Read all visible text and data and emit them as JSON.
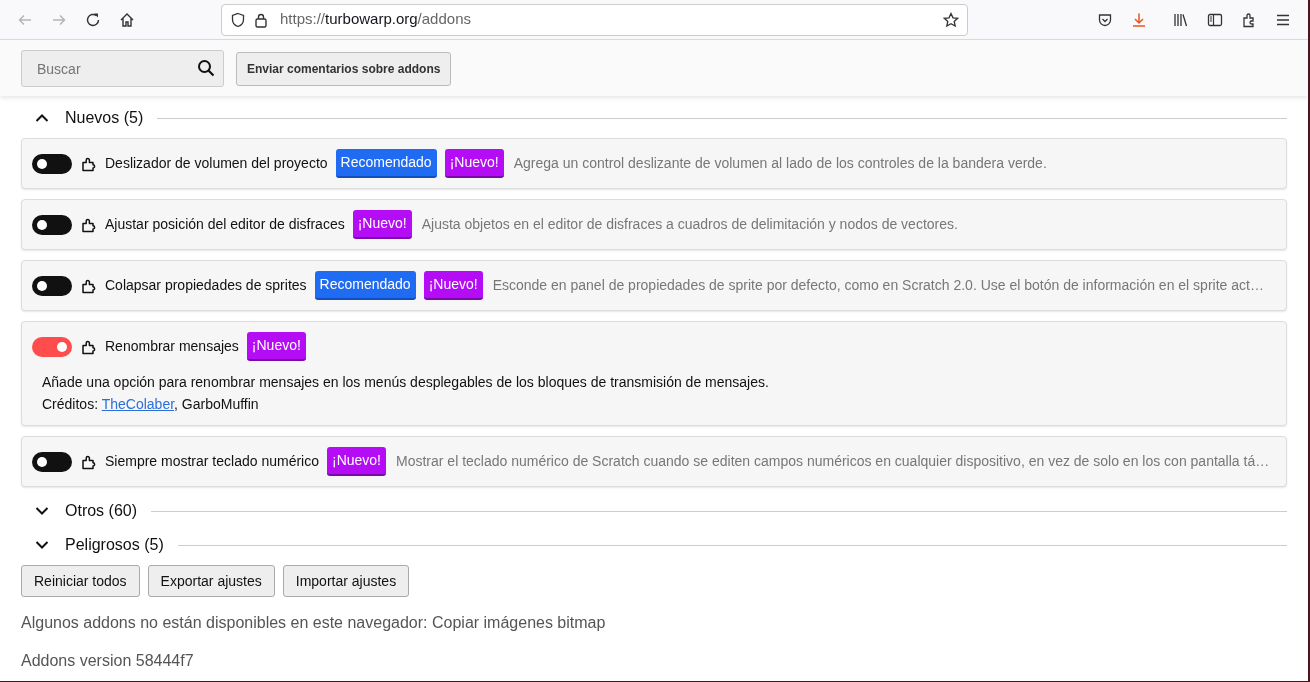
{
  "browser": {
    "url": {
      "scheme": "https://",
      "host": "turbowarp.org",
      "path": "/addons"
    },
    "back_disabled": true,
    "forward_disabled": true,
    "download_active": true
  },
  "toolbar": {
    "search": {
      "placeholder": "Buscar"
    },
    "feedback_button": "Enviar comentarios sobre addons"
  },
  "sections": [
    {
      "title": "Nuevos (5)",
      "expanded": true,
      "addons": [
        {
          "name": "Deslizador de volumen del proyecto",
          "on": false,
          "expanded": false,
          "badges": [
            {
              "kind": "recommended",
              "label": "Recomendado"
            },
            {
              "kind": "new",
              "label": "¡Nuevo!"
            }
          ],
          "description": "Agrega un control deslizante de volumen al lado de los controles de la bandera verde."
        },
        {
          "name": "Ajustar posición del editor de disfraces",
          "on": false,
          "expanded": false,
          "badges": [
            {
              "kind": "new",
              "label": "¡Nuevo!"
            }
          ],
          "description": "Ajusta objetos en el editor de disfraces a cuadros de delimitación y nodos de vectores."
        },
        {
          "name": "Colapsar propiedades de sprites",
          "on": false,
          "expanded": false,
          "badges": [
            {
              "kind": "recommended",
              "label": "Recomendado"
            },
            {
              "kind": "new",
              "label": "¡Nuevo!"
            }
          ],
          "description": "Esconde en panel de propiedades de sprite por defecto, como en Scratch 2.0. Use el botón de información en el sprite act…"
        },
        {
          "name": "Renombrar mensajes",
          "on": true,
          "expanded": true,
          "badges": [
            {
              "kind": "new",
              "label": "¡Nuevo!"
            }
          ],
          "description": "Añade una opción para renombrar mensajes en los menús desplegables de los bloques de transmisión de mensajes.",
          "credits_label": "Créditos:",
          "credits_separator": ", ",
          "credits": [
            {
              "name": "TheColaber",
              "link": true
            },
            {
              "name": "GarboMuffin",
              "link": false
            }
          ]
        },
        {
          "name": "Siempre mostrar teclado numérico",
          "on": false,
          "expanded": false,
          "badges": [
            {
              "kind": "new",
              "label": "¡Nuevo!"
            }
          ],
          "description": "Mostrar el teclado numérico de Scratch cuando se editen campos numéricos en cualquier dispositivo, en vez de solo en los con pantalla tá…"
        }
      ]
    },
    {
      "title": "Otros (60)",
      "expanded": false
    },
    {
      "title": "Peligrosos (5)",
      "expanded": false
    }
  ],
  "footer_buttons": [
    "Reiniciar todos",
    "Exportar ajustes",
    "Importar ajustes"
  ],
  "unsupported_note": "Algunos addons no están disponibles en este navegador: Copiar imágenes bitmap",
  "version": "Addons version 58444f7"
}
